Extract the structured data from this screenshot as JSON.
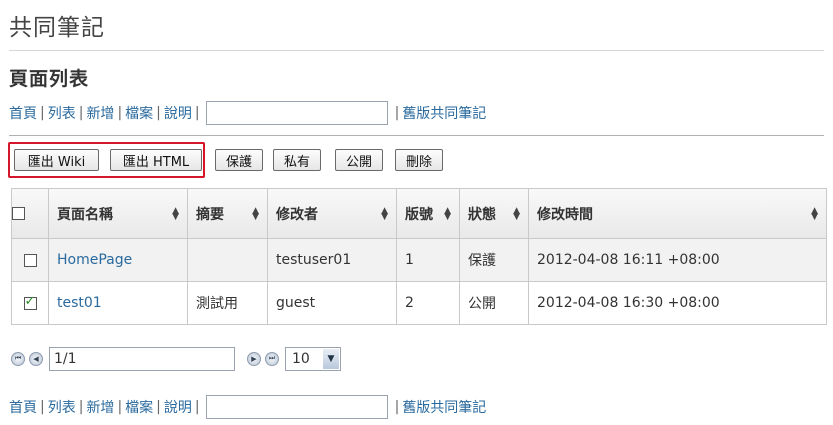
{
  "app_title": "共同筆記",
  "page_title": "頁面列表",
  "nav": {
    "links": [
      "首頁",
      "列表",
      "新增",
      "檔案",
      "說明"
    ],
    "search_value": "",
    "old_link": "舊版共同筆記"
  },
  "toolbar": {
    "buttons": [
      "匯出 Wiki",
      "匯出 HTML",
      "保護",
      "私有",
      "公開",
      "刪除"
    ]
  },
  "table": {
    "headers": [
      "頁面名稱",
      "摘要",
      "修改者",
      "版號",
      "狀態",
      "修改時間"
    ],
    "rows": [
      {
        "checked": false,
        "name": "HomePage",
        "summary": "",
        "modifier": "testuser01",
        "version": "1",
        "status": "保護",
        "time": "2012-04-08 16:11 +08:00"
      },
      {
        "checked": true,
        "name": "test01",
        "summary": "測試用",
        "modifier": "guest",
        "version": "2",
        "status": "公開",
        "time": "2012-04-08 16:30 +08:00"
      }
    ]
  },
  "pager": {
    "page_value": "1/1",
    "page_size": "10"
  }
}
